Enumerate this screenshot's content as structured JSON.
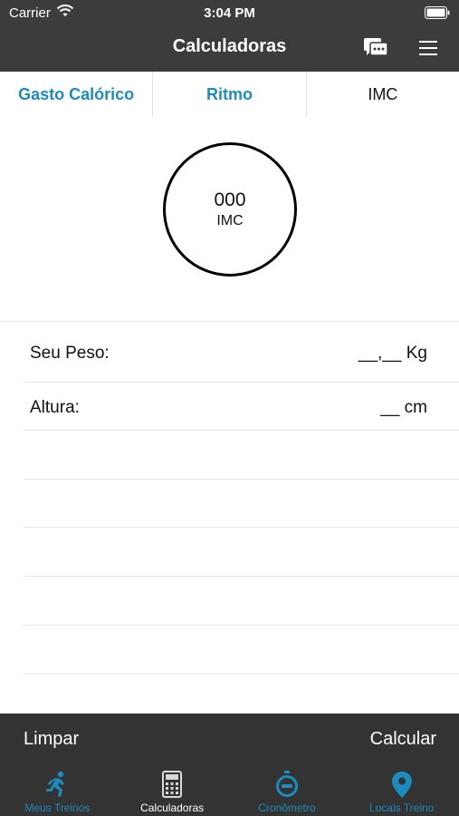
{
  "status": {
    "carrier": "Carrier",
    "time": "3:04 PM"
  },
  "nav": {
    "title": "Calculadoras",
    "icons": [
      "chat-icon",
      "menu-icon"
    ]
  },
  "segments": [
    "Gasto Calórico",
    "Ritmo",
    "IMC"
  ],
  "result": {
    "value": "000",
    "unit": "IMC"
  },
  "form": {
    "weight": {
      "label": "Seu Peso:",
      "value": "__,__ Kg"
    },
    "height": {
      "label": "Altura:",
      "value": "__ cm"
    }
  },
  "actions": {
    "clear": "Limpar",
    "calculate": "Calcular"
  },
  "tabs": [
    {
      "label": "Meus Treinos",
      "icon": "runner-icon"
    },
    {
      "label": "Calculadoras",
      "icon": "calculator-icon"
    },
    {
      "label": "Cronômetro",
      "icon": "stopwatch-icon"
    },
    {
      "label": "Locais Treino",
      "icon": "map-pin-icon"
    }
  ],
  "colors": {
    "accent": "#1c8bbd",
    "bar": "#3c3c3c",
    "bottom": "#333333"
  }
}
